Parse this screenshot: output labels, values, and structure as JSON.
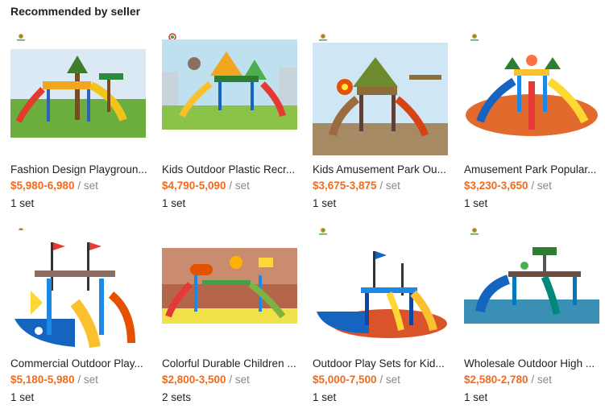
{
  "section": {
    "title": "Recommended by seller"
  },
  "products": [
    {
      "title": "Fashion Design Playgroun...",
      "price": "$5,980-6,980",
      "unit": " / set",
      "moq": "1 set",
      "theme": "tree-slide"
    },
    {
      "title": "Kids Outdoor Plastic Recr...",
      "price": "$4,790-5,090",
      "unit": " / set",
      "moq": "1 set",
      "theme": "park-city"
    },
    {
      "title": "Kids Amusement Park Ou...",
      "price": "$3,675-3,875",
      "unit": " / set",
      "moq": "1 set",
      "theme": "jungle"
    },
    {
      "title": "Amusement Park Popular...",
      "price": "$3,230-3,650",
      "unit": " / set",
      "moq": "1 set",
      "theme": "palm-slides"
    },
    {
      "title": "Commercial Outdoor Play...",
      "price": "$5,180-5,980",
      "unit": " / set",
      "moq": "1 set",
      "theme": "pirate"
    },
    {
      "title": "Colorful Durable Children ...",
      "price": "$2,800-3,500",
      "unit": " / set",
      "moq": "2 sets",
      "theme": "colorful"
    },
    {
      "title": "Outdoor Play Sets for Kid...",
      "price": "$5,000-7,500",
      "unit": " / set",
      "moq": "1 set",
      "theme": "pirate-ship"
    },
    {
      "title": "Wholesale Outdoor High ...",
      "price": "$2,580-2,780",
      "unit": " / set",
      "moq": "1 set",
      "theme": "water-park"
    }
  ],
  "colors": {
    "price": "#f26a1b",
    "unit": "#888888",
    "title": "#222222"
  }
}
